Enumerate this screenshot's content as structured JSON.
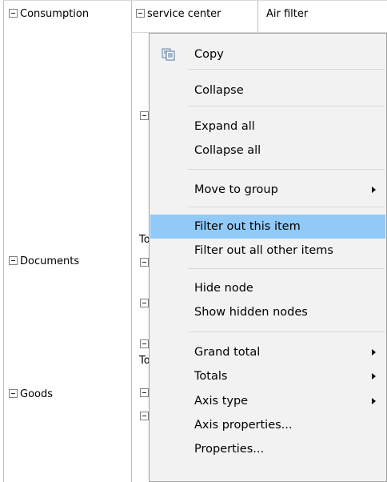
{
  "pivot": {
    "row_fields": [
      {
        "label": "Consumption"
      },
      {
        "label": "Documents"
      },
      {
        "label": "Goods"
      }
    ],
    "header": {
      "service_label": "service center",
      "item_label": "Air filter"
    },
    "partial_totals": [
      "To",
      "To"
    ]
  },
  "context_menu": {
    "items": [
      {
        "label": "Copy",
        "icon": "copy-icon",
        "submenu": false,
        "highlighted": false
      },
      {
        "label": "Collapse",
        "submenu": false,
        "highlighted": false
      },
      {
        "label": "Expand all",
        "submenu": false,
        "highlighted": false
      },
      {
        "label": "Collapse all",
        "submenu": false,
        "highlighted": false
      },
      {
        "label": "Move to group",
        "submenu": true,
        "highlighted": false
      },
      {
        "label": "Filter out this item",
        "submenu": false,
        "highlighted": true
      },
      {
        "label": "Filter out all other items",
        "submenu": false,
        "highlighted": false
      },
      {
        "label": "Hide node",
        "submenu": false,
        "highlighted": false
      },
      {
        "label": "Show hidden nodes",
        "submenu": false,
        "highlighted": false
      },
      {
        "label": "Grand total",
        "submenu": true,
        "highlighted": false
      },
      {
        "label": "Totals",
        "submenu": true,
        "highlighted": false
      },
      {
        "label": "Axis type",
        "submenu": true,
        "highlighted": false
      },
      {
        "label": "Axis properties...",
        "submenu": false,
        "highlighted": false
      },
      {
        "label": "Properties...",
        "submenu": false,
        "highlighted": false
      }
    ],
    "highlight_color": "#91c9f7",
    "background_color": "#f2f2f2"
  }
}
